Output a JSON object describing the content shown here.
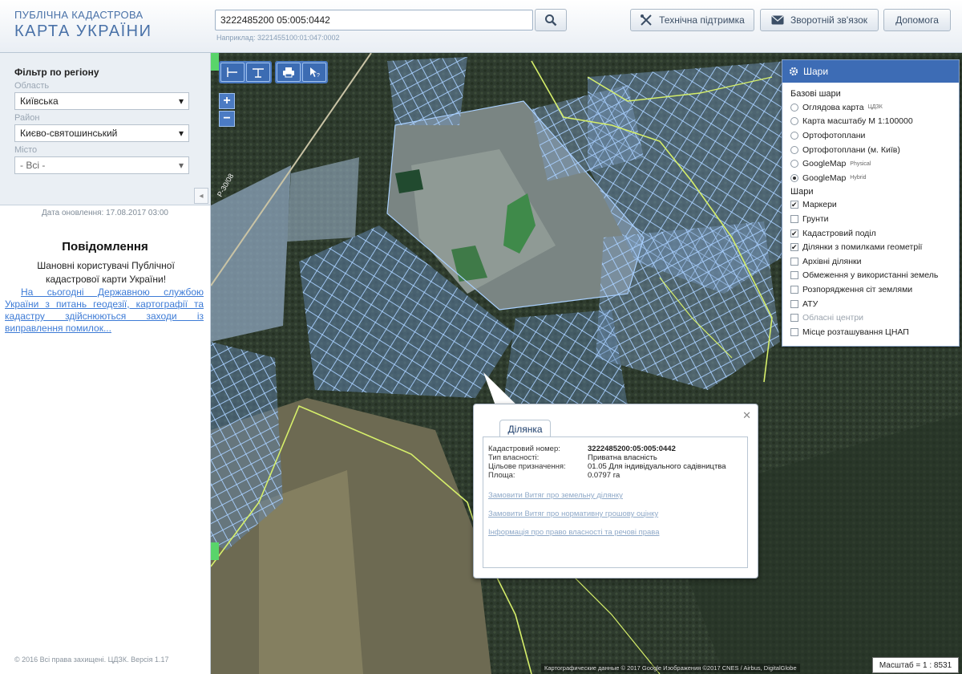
{
  "header": {
    "logo_line1": "ПУБЛІЧНА КАДАСТРОВА",
    "logo_line2": "КАРТА УКРАЇНИ",
    "search_value": "3222485200 05:005:0442",
    "search_hint": "Наприклад: 3221455100:01:047:0002",
    "support_label": "Технічна підтримка",
    "feedback_label": "Зворотній зв'язок",
    "help_label": "Допомога"
  },
  "filter": {
    "title": "Фільтр по регіону",
    "region_label": "Область",
    "region_value": "Київська",
    "district_label": "Район",
    "district_value": "Києво-святошинський",
    "city_label": "Місто",
    "city_value": "- Всі -"
  },
  "sidebar": {
    "update_date": "Дата оновлення: 17.08.2017 03:00",
    "message_title": "Повідомлення",
    "message_text": "Шановні користувачі Публічної кадастрової карти України!",
    "message_link": "На сьогодні Державною службою України з питань геодезії, картографії та кадастру здійснюються заходи із виправлення помилок...",
    "copyright": "© 2016 Всі права захищені. ЦДЗК. Версія 1.17"
  },
  "map": {
    "road_label": "Р-30/08",
    "zoom_in": "+",
    "zoom_out": "−",
    "credits": "Картографические данные © 2017 Google Изображения ©2017 CNES / Airbus, DigitalGlobe",
    "scale": "Масштаб = 1 : 8531"
  },
  "layers": {
    "title": "Шари",
    "base_title": "Базові шари",
    "base": [
      {
        "label": "Оглядова карта",
        "sup": "ЦДЗК",
        "checked": false
      },
      {
        "label": "Карта масштабу М 1:100000",
        "sup": "",
        "checked": false
      },
      {
        "label": "Ортофотоплани",
        "sup": "",
        "checked": false
      },
      {
        "label": "Ортофотоплани (м. Київ)",
        "sup": "",
        "checked": false
      },
      {
        "label": "GoogleMap",
        "sup": "Physical",
        "checked": false
      },
      {
        "label": "GoogleMap",
        "sup": "Hybrid",
        "checked": true
      }
    ],
    "overlay_title": "Шари",
    "overlays": [
      {
        "label": "Маркери",
        "checked": true,
        "disabled": false
      },
      {
        "label": "Грунти",
        "checked": false,
        "disabled": false
      },
      {
        "label": "Кадастровий поділ",
        "checked": true,
        "disabled": false
      },
      {
        "label": "Ділянки з помилками геометрії",
        "checked": true,
        "disabled": false
      },
      {
        "label": "Архівні ділянки",
        "checked": false,
        "disabled": false
      },
      {
        "label": "Обмеження у використанні земель",
        "checked": false,
        "disabled": false
      },
      {
        "label": "Розпорядження сіт землями",
        "checked": false,
        "disabled": false
      },
      {
        "label": "АТУ",
        "checked": false,
        "disabled": false
      },
      {
        "label": "Обласні центри",
        "checked": false,
        "disabled": true
      },
      {
        "label": "Місце розташування ЦНАП",
        "checked": false,
        "disabled": false
      }
    ]
  },
  "parcel": {
    "tab": "Ділянка",
    "rows": [
      {
        "key": "Кадастровий номер:",
        "value": "3222485200:05:005:0442",
        "bold": true
      },
      {
        "key": "Тип власності:",
        "value": "Приватна власність",
        "bold": false
      },
      {
        "key": "Цільове призначення:",
        "value": "01.05 Для індивідуального садівництва",
        "bold": false
      },
      {
        "key": "Площа:",
        "value": "0.0797 га",
        "bold": false
      }
    ],
    "links": [
      "Замовити Витяг про земельну ділянку",
      "Замовити Витяг про нормативну грошову оцінку",
      "Інформація про право власності та речові права"
    ]
  },
  "colors": {
    "brand_blue": "#3d6cb5",
    "parcel_outline": "#a9d0ff",
    "boundary_line": "#d6ef6a",
    "link": "#3d7bd6"
  }
}
